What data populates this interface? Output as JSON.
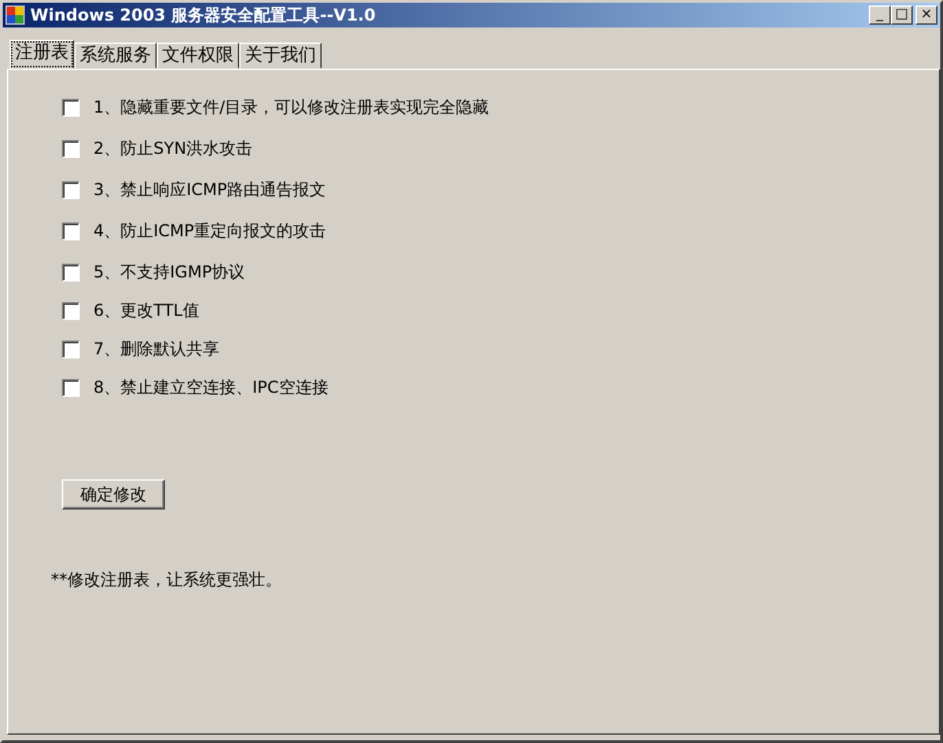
{
  "window": {
    "title": "Windows 2003 服务器安全配置工具--V1.0",
    "controls": [
      "_",
      "□",
      "×"
    ]
  },
  "tabs": [
    {
      "label": "注册表",
      "selected": true
    },
    {
      "label": "系统服务",
      "selected": false
    },
    {
      "label": "文件权限",
      "selected": false
    },
    {
      "label": "关于我们",
      "selected": false
    }
  ],
  "options": [
    {
      "label": "1、隐藏重要文件/目录，可以修改注册表实现完全隐藏",
      "checked": false
    },
    {
      "label": "2、防止SYN洪水攻击",
      "checked": false
    },
    {
      "label": "3、禁止响应ICMP路由通告报文",
      "checked": false
    },
    {
      "label": "4、防止ICMP重定向报文的攻击",
      "checked": false
    },
    {
      "label": "5、不支持IGMP协议",
      "checked": false
    },
    {
      "label": "6、更改TTL值",
      "checked": false
    },
    {
      "label": "7、删除默认共享",
      "checked": false
    },
    {
      "label": "8、禁止建立空连接、IPC空连接",
      "checked": false
    }
  ],
  "apply_button": "确定修改",
  "note": "**修改注册表，让系统更强壮。"
}
